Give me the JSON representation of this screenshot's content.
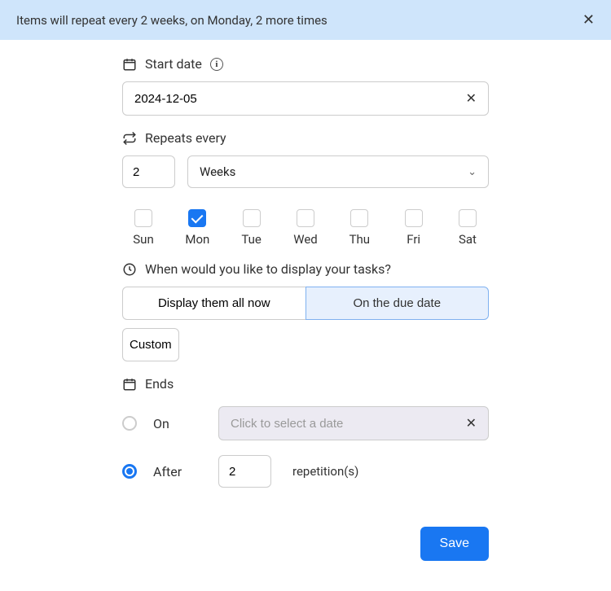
{
  "banner": {
    "text": "Items will repeat every 2 weeks, on Monday, 2 more times"
  },
  "start_date": {
    "label": "Start date",
    "value": "2024-12-05"
  },
  "repeats": {
    "label": "Repeats every",
    "interval": "2",
    "unit": "Weeks",
    "days": [
      {
        "short": "Sun",
        "checked": false
      },
      {
        "short": "Mon",
        "checked": true
      },
      {
        "short": "Tue",
        "checked": false
      },
      {
        "short": "Wed",
        "checked": false
      },
      {
        "short": "Thu",
        "checked": false
      },
      {
        "short": "Fri",
        "checked": false
      },
      {
        "short": "Sat",
        "checked": false
      }
    ]
  },
  "display": {
    "label": "When would you like to display your tasks?",
    "opt_all": "Display them all now",
    "opt_due": "On the due date",
    "opt_custom": "Custom"
  },
  "ends": {
    "label": "Ends",
    "on_label": "On",
    "on_placeholder": "Click to select a date",
    "after_label": "After",
    "after_value": "2",
    "repetitions_label": "repetition(s)"
  },
  "save_label": "Save"
}
